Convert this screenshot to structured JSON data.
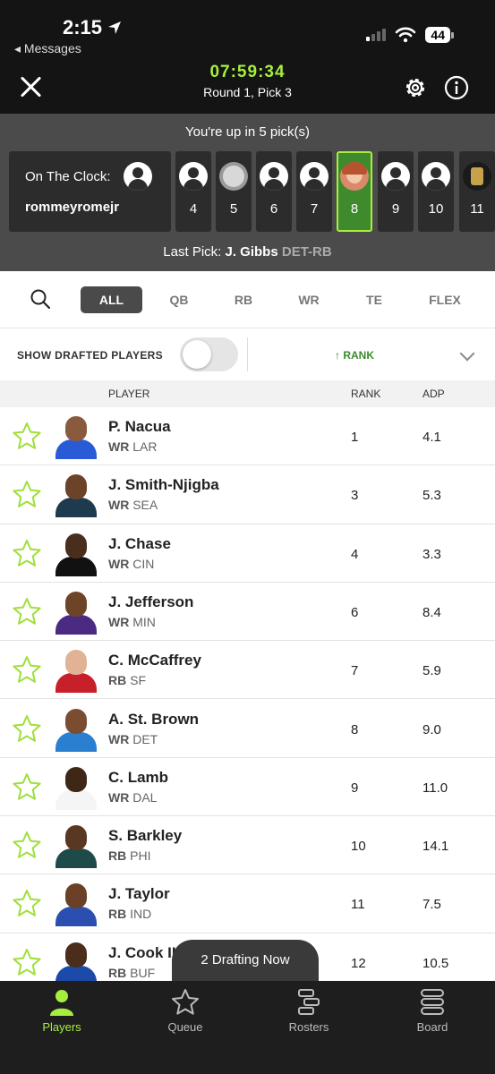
{
  "status_bar": {
    "time": "2:15",
    "back_label": "◂ Messages",
    "battery": "44"
  },
  "header": {
    "timer": "07:59:34",
    "round": "Round 1, Pick 3"
  },
  "picks": {
    "up_in": "You're up in 5 pick(s)",
    "on_the_clock_label": "On The Clock:",
    "on_the_clock_user": "rommeyromejr",
    "slots": [
      "4",
      "5",
      "6",
      "7",
      "8",
      "9",
      "10",
      "11"
    ],
    "active_slot": "8",
    "last_pick_label": "Last Pick:",
    "last_pick_player": "J. Gibbs",
    "last_pick_pos": "DET-RB"
  },
  "filters": {
    "tabs": [
      "ALL",
      "QB",
      "RB",
      "WR",
      "TE",
      "FLEX"
    ],
    "active": "ALL"
  },
  "drafted": {
    "label": "SHOW DRAFTED PLAYERS",
    "toggle_on": false,
    "sort_label": "↑ RANK"
  },
  "columns": {
    "player": "PLAYER",
    "rank": "RANK",
    "adp": "ADP"
  },
  "players": [
    {
      "name": "P. Nacua",
      "pos": "WR",
      "team": "LAR",
      "rank": "1",
      "adp": "4.1"
    },
    {
      "name": "J. Smith-Njigba",
      "pos": "WR",
      "team": "SEA",
      "rank": "3",
      "adp": "5.3"
    },
    {
      "name": "J. Chase",
      "pos": "WR",
      "team": "CIN",
      "rank": "4",
      "adp": "3.3"
    },
    {
      "name": "J. Jefferson",
      "pos": "WR",
      "team": "MIN",
      "rank": "6",
      "adp": "8.4"
    },
    {
      "name": "C. McCaffrey",
      "pos": "RB",
      "team": "SF",
      "rank": "7",
      "adp": "5.9"
    },
    {
      "name": "A. St. Brown",
      "pos": "WR",
      "team": "DET",
      "rank": "8",
      "adp": "9.0"
    },
    {
      "name": "C. Lamb",
      "pos": "WR",
      "team": "DAL",
      "rank": "9",
      "adp": "11.0"
    },
    {
      "name": "S. Barkley",
      "pos": "RB",
      "team": "PHI",
      "rank": "10",
      "adp": "14.1"
    },
    {
      "name": "J. Taylor",
      "pos": "RB",
      "team": "IND",
      "rank": "11",
      "adp": "7.5"
    },
    {
      "name": "J. Cook III",
      "pos": "RB",
      "team": "BUF",
      "rank": "12",
      "adp": "10.5"
    }
  ],
  "drafting_now": "2 Drafting Now",
  "bottom_nav": [
    {
      "label": "Players",
      "icon": "player-icon"
    },
    {
      "label": "Queue",
      "icon": "star-icon"
    },
    {
      "label": "Rosters",
      "icon": "rosters-icon"
    },
    {
      "label": "Board",
      "icon": "board-icon"
    }
  ],
  "colors": {
    "accent": "#a6ef3e",
    "dark": "#141414",
    "pick_bg": "#4b4b4b",
    "rank_green": "#3c8a2a"
  }
}
